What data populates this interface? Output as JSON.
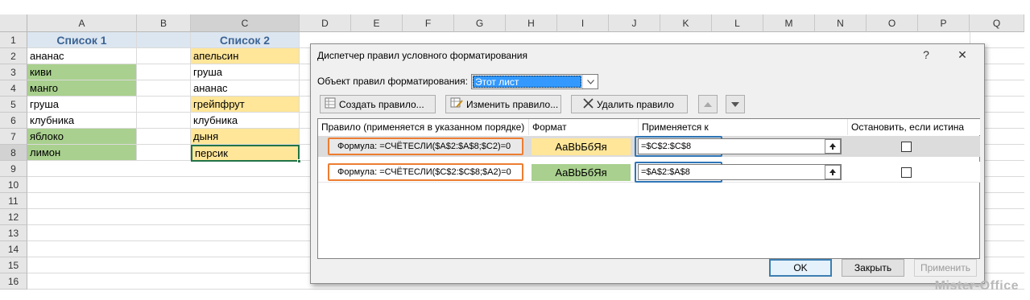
{
  "sheet": {
    "columns": [
      "A",
      "B",
      "C",
      "D",
      "E",
      "F",
      "G",
      "H",
      "I",
      "J",
      "K",
      "L",
      "M",
      "N",
      "O",
      "P",
      "Q"
    ],
    "rows": [
      "1",
      "2",
      "3",
      "4",
      "5",
      "6",
      "7",
      "8",
      "9",
      "10",
      "11",
      "12",
      "13",
      "14",
      "15",
      "16"
    ],
    "header_a": "Список 1",
    "header_c": "Список 2",
    "list1": [
      "ананас",
      "киви",
      "манго",
      "груша",
      "клубника",
      "яблоко",
      "лимон"
    ],
    "list2": [
      "апельсин",
      "груша",
      "ананас",
      "грейпфрут",
      "клубника",
      "дыня",
      "персик"
    ],
    "colors": {
      "green": "#a9d08e",
      "yellow": "#ffe699",
      "header": "#dce6f1"
    }
  },
  "dialog": {
    "title": "Диспетчер правил условного форматирования",
    "help": "?",
    "close": "✕",
    "scope_label": "Объект правил форматирования:",
    "scope_value": "Этот лист",
    "buttons": {
      "new_rule": "Создать правило...",
      "edit_rule": "Изменить правило...",
      "delete_rule": "Удалить правило"
    },
    "columns": {
      "rule": "Правило (применяется в указанном порядке)",
      "format": "Формат",
      "applies": "Применяется к",
      "stop": "Остановить, если истина"
    },
    "rules": [
      {
        "formula": "Формула: =СЧЁТЕСЛИ($A$2:$A$8;$C2)=0",
        "preview": "АаВbБбЯя",
        "applies_to": "=$C$2:$C$8",
        "color": "#ffe699"
      },
      {
        "formula": "Формула: =СЧЁТЕСЛИ($C$2:$C$8;$A2)=0",
        "preview": "АаВbБбЯя",
        "applies_to": "=$A$2:$A$8",
        "color": "#a9d08e"
      }
    ],
    "footer": {
      "ok": "OK",
      "close": "Закрыть",
      "apply": "Применить"
    }
  },
  "watermark": "Mister-Office"
}
